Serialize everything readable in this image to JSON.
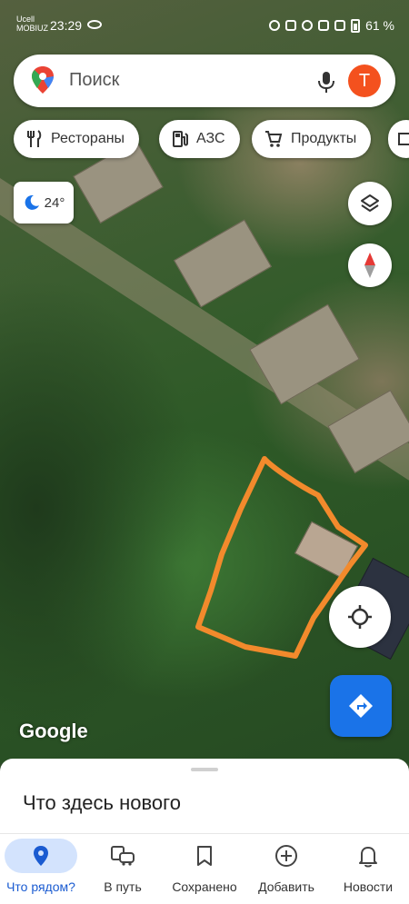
{
  "status_bar": {
    "carrier_line1": "Ucell",
    "carrier_line2": "MOBIUZ",
    "time": "23:29",
    "battery": "61 %"
  },
  "search": {
    "placeholder": "Поиск",
    "avatar_letter": "T"
  },
  "chips": [
    {
      "label": "Рестораны",
      "icon": "fork-knife-icon"
    },
    {
      "label": "АЗС",
      "icon": "gas-station-icon"
    },
    {
      "label": "Продукты",
      "icon": "cart-icon"
    }
  ],
  "weather": {
    "temperature": "24°",
    "icon": "moon-cloud-icon"
  },
  "map": {
    "attribution": "Google",
    "type": "satellite"
  },
  "sheet": {
    "title": "Что здесь нового"
  },
  "bottom_nav": [
    {
      "label": "Что рядом?",
      "icon": "location-pin-icon",
      "active": true
    },
    {
      "label": "В путь",
      "icon": "commute-icon",
      "active": false
    },
    {
      "label": "Сохранено",
      "icon": "bookmark-icon",
      "active": false
    },
    {
      "label": "Добавить",
      "icon": "add-circle-icon",
      "active": false
    },
    {
      "label": "Новости",
      "icon": "bell-icon",
      "active": false
    }
  ],
  "colors": {
    "accent": "#1a73e8",
    "avatar": "#f4511e",
    "active_nav_bg": "#d3e3fd",
    "outline": "#f28a2c"
  }
}
